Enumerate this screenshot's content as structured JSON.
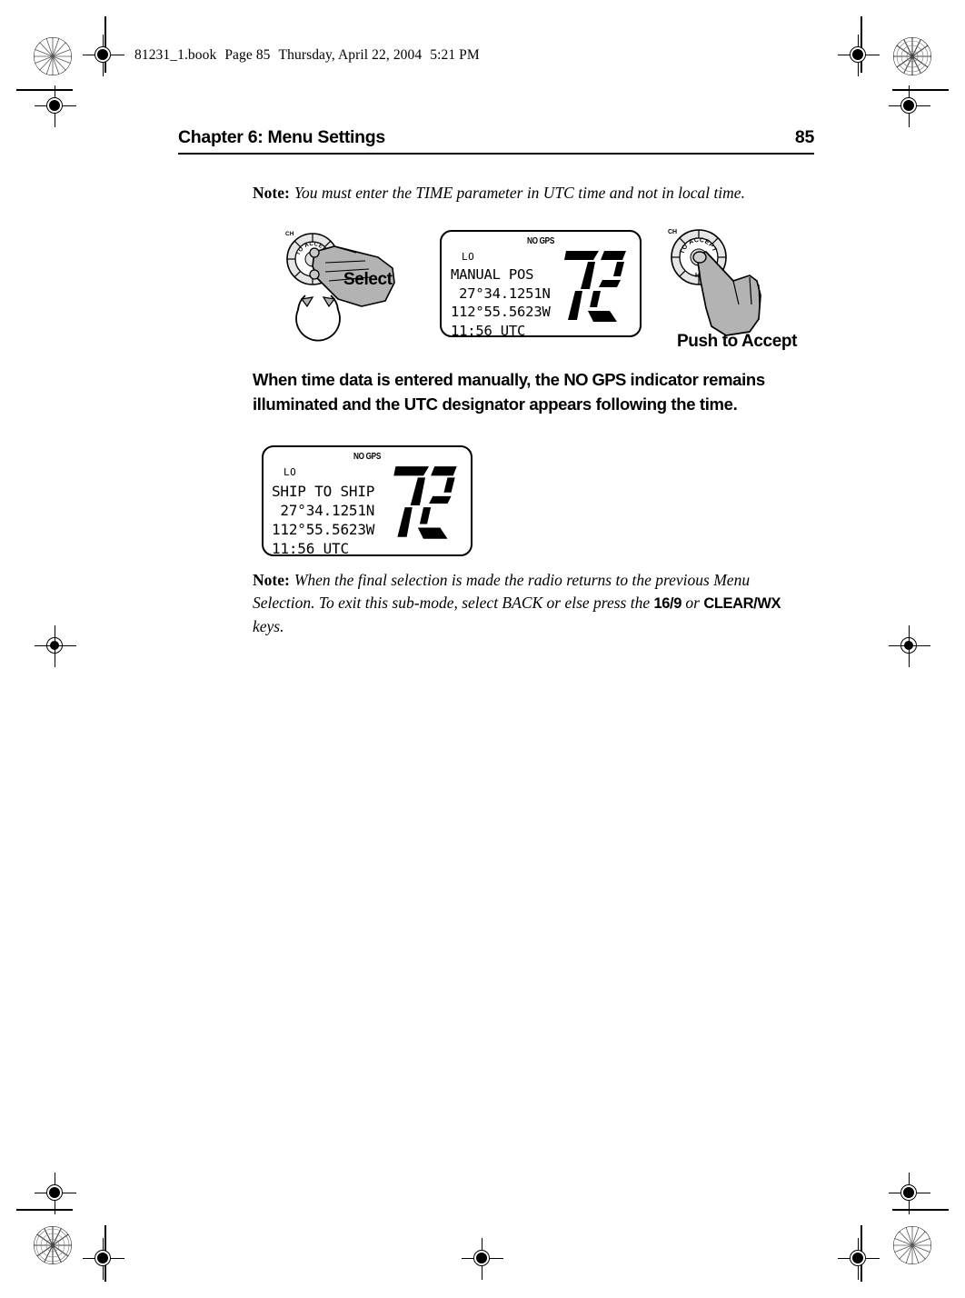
{
  "printmark": {
    "filename_parts": [
      "81231_1.book",
      "Page 85",
      "Thursday, April 22, 2004",
      "5:21 PM"
    ]
  },
  "header": {
    "chapter": "Chapter 6: Menu Settings",
    "page_number": "85"
  },
  "note_top": {
    "lead": "Note:",
    "text": "You must enter the TIME parameter in UTC time and not in local time."
  },
  "figure_top": {
    "knob_select": {
      "knob_label_ch": "CH",
      "knob_ring_text": "PUSH TO ACCEPT",
      "caption": "Select"
    },
    "knob_push": {
      "knob_label_ch": "CH",
      "knob_ring_text": "PUSH TO ACCEPT",
      "caption": "Push to Accept"
    },
    "lcd": {
      "no_gps": "NO GPS",
      "lo": "LO",
      "line1": "MANUAL POS",
      "line2": " 27°34.1251N",
      "line3": "112°55.5623W",
      "line4": "11:56 UTC",
      "channel": "72"
    }
  },
  "body_paragraph": {
    "part1": "When time data is entered manually, the ",
    "kbd": "NO GPS",
    "part2": " indicator remains illuminated and the UTC designator appears following the time."
  },
  "figure_bottom": {
    "lcd": {
      "no_gps": "NO GPS",
      "lo": "LO",
      "line1": "SHIP TO SHIP",
      "line2": " 27°34.1251N",
      "line3": "112°55.5623W",
      "line4": "11:56 UTC",
      "channel": "72"
    }
  },
  "note_bottom": {
    "lead": "Note:",
    "part1": "When the final selection is made the radio returns to the previous Menu Selection. To exit this sub-mode, select BACK or else press the ",
    "kbd1": "16/9",
    "part2": " or ",
    "kbd2": "CLEAR/WX",
    "part3": " keys."
  },
  "colors": {
    "ink": "#000000",
    "page": "#ffffff",
    "hand_fill": "#b3b3b3",
    "knob_fill": "#e6e6e6"
  }
}
